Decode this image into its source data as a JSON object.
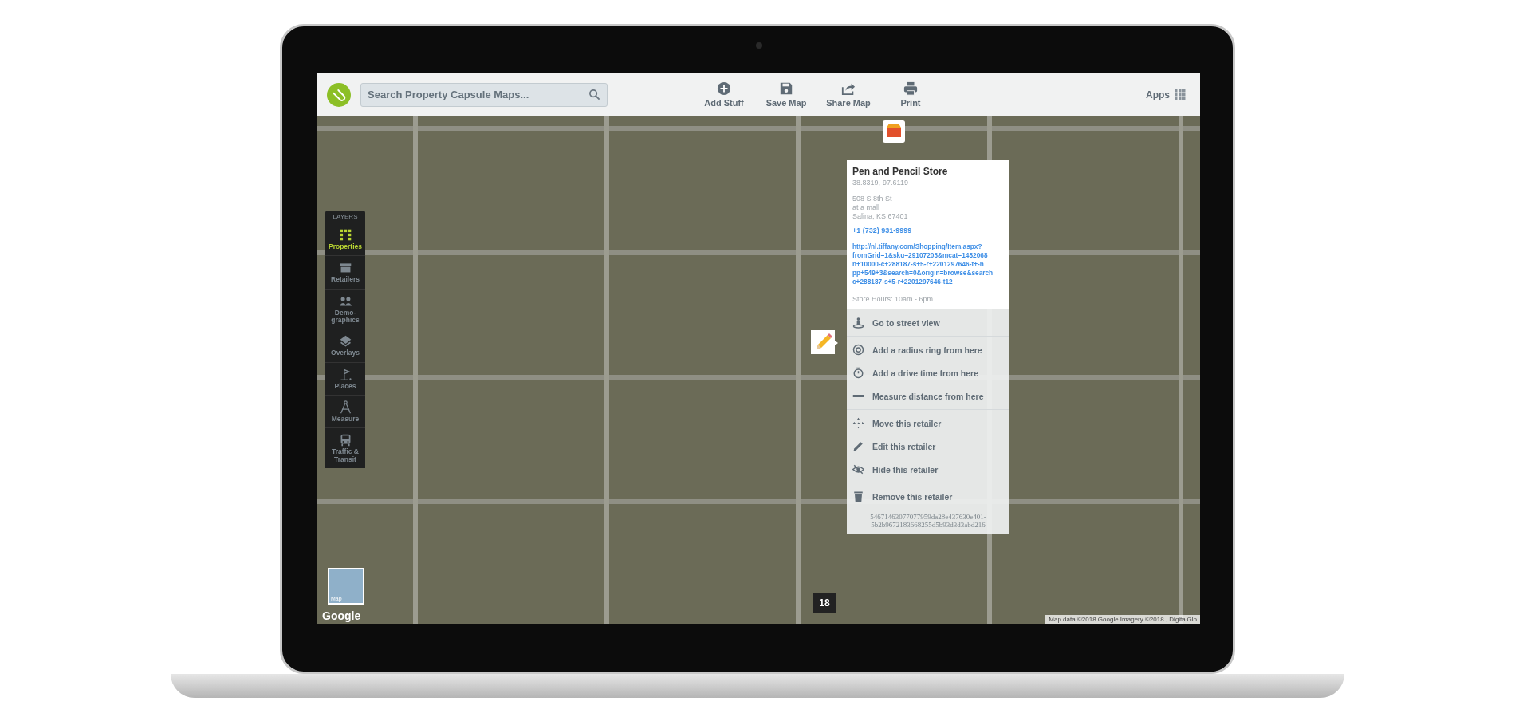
{
  "topbar": {
    "search": {
      "placeholder": "Search Property Capsule Maps..."
    },
    "actions": [
      "Add Stuff",
      "Save Map",
      "Share Map",
      "Print"
    ],
    "apps": "Apps"
  },
  "layers": {
    "title": "LAYERS",
    "items": [
      {
        "label": "Properties",
        "selected": true
      },
      {
        "label": "Retailers",
        "selected": false
      },
      {
        "label": "Demo-graphics",
        "selected": false
      },
      {
        "label": "Overlays",
        "selected": false
      },
      {
        "label": "Places",
        "selected": false
      },
      {
        "label": "Measure",
        "selected": false
      },
      {
        "label": "Traffic & Transit",
        "selected": false
      }
    ]
  },
  "popup": {
    "title": "Pen and Pencil Store",
    "coordinates": "38.8319,-97.6119",
    "address_lines": [
      "508 S 8th St",
      "at a mall",
      "Salina, KS 67401"
    ],
    "phone": "+1 (732) 931-9999",
    "url_lines": [
      "http://nl.tiffany.com/Shopping/Item.aspx?",
      "fromGrid=1&sku=29107203&mcat=1482068",
      "n+10000-c+288187-s+5-r+2201297646-t+-n",
      "pp+549+3&search=0&origin=browse&search",
      "c+288187-s+5-r+2201297646-t12"
    ],
    "hours": "Store Hours: 10am - 6pm",
    "menu_groups": [
      [
        "Go to street view"
      ],
      [
        "Add a radius ring from here",
        "Add a drive time from here",
        "Measure distance from here"
      ],
      [
        "Move this retailer",
        "Edit this retailer",
        "Hide this retailer"
      ],
      [
        "Remove this retailer"
      ]
    ],
    "id_lines": [
      "54671463077077959da28e437630e401-",
      "5b2b9672183668255d5b93d3d3abd216"
    ]
  },
  "map": {
    "zoom_level": "18",
    "mini_map_label": "Map",
    "logo": "Google",
    "attribution": "Map data ©2018 Google Imagery ©2018 , DigitalGlo"
  }
}
